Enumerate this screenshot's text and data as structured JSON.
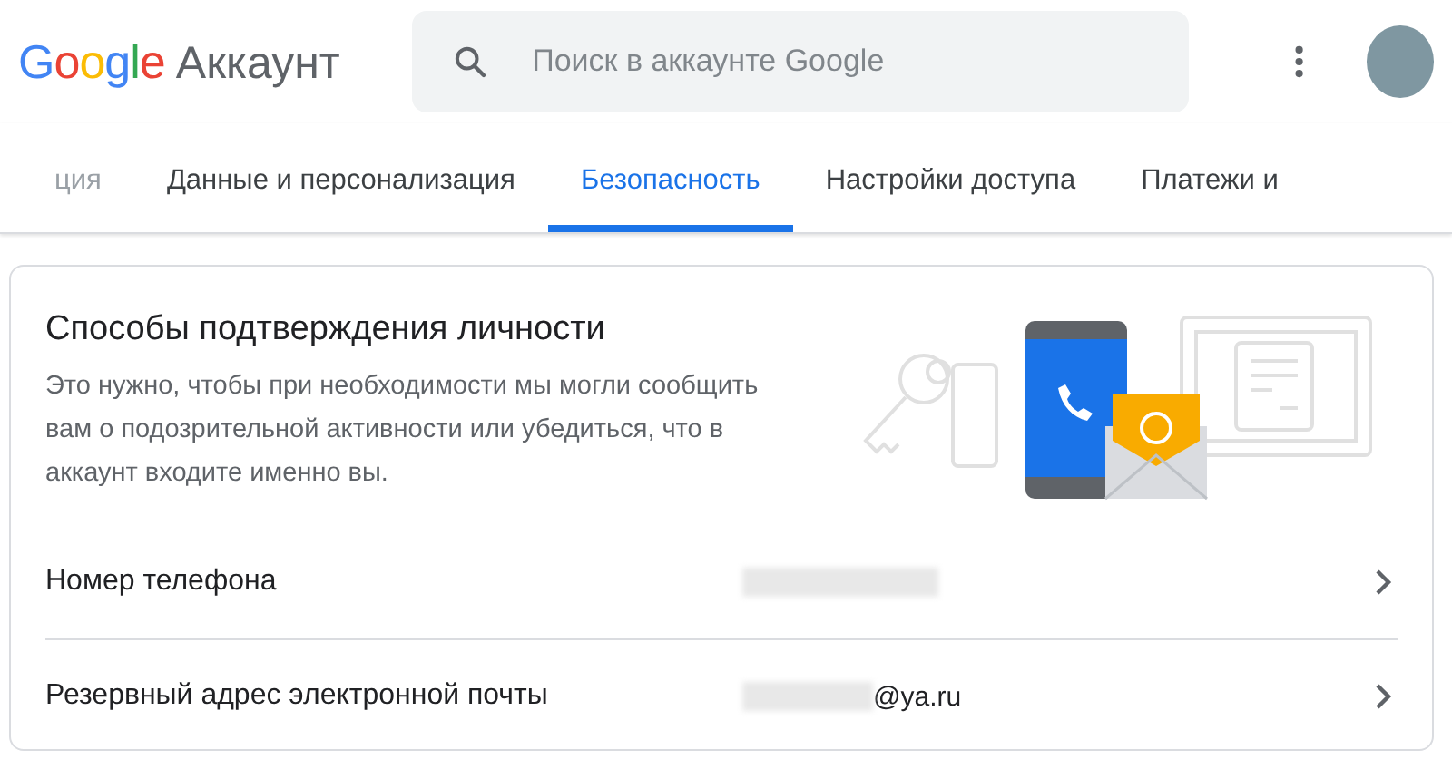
{
  "header": {
    "logo": "Google",
    "product": "Аккаунт",
    "search": {
      "placeholder": "Поиск в аккаунте Google"
    }
  },
  "tabs": [
    {
      "label": "ция",
      "selected": false
    },
    {
      "label": "Данные и персонализация",
      "selected": false
    },
    {
      "label": "Безопасность",
      "selected": true
    },
    {
      "label": "Настройки доступа",
      "selected": false
    },
    {
      "label": "Платежи и",
      "selected": false
    }
  ],
  "card": {
    "title": "Способы подтверждения личности",
    "description": "Это нужно, чтобы при необходимости мы могли сообщить вам о подозрительной активности или убедиться, что в аккаунт входите именно вы.",
    "rows": [
      {
        "label": "Номер телефона",
        "kind": "hidden"
      },
      {
        "label": "Резервный адрес электронной почты",
        "kind": "partial",
        "suffix": "@ya.ru"
      }
    ]
  }
}
